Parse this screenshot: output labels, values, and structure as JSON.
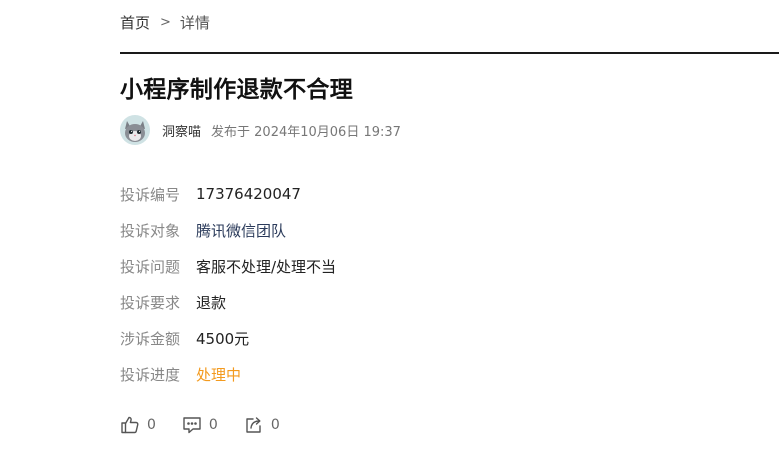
{
  "breadcrumb": {
    "home": "首页",
    "separator": ">",
    "current": "详情"
  },
  "article": {
    "title": "小程序制作退款不合理",
    "author": "洞察喵",
    "published": "发布于 2024年10月06日 19:37"
  },
  "complaint": {
    "fields": [
      {
        "label": "投诉编号",
        "value": "17376420047"
      },
      {
        "label": "投诉对象",
        "value": "腾讯微信团队"
      },
      {
        "label": "投诉问题",
        "value": "客服不处理/处理不当"
      },
      {
        "label": "投诉要求",
        "value": "退款"
      },
      {
        "label": "涉诉金额",
        "value": "4500元"
      },
      {
        "label": "投诉进度",
        "value": "处理中"
      }
    ]
  },
  "actions": {
    "like_count": "0",
    "comment_count": "0",
    "share_count": "0",
    "icons": [
      "thumbs-up-icon",
      "comment-icon",
      "share-icon"
    ]
  },
  "colors": {
    "status": "#f39a1e",
    "divider": "#1a1a1a",
    "label": "#888888"
  }
}
